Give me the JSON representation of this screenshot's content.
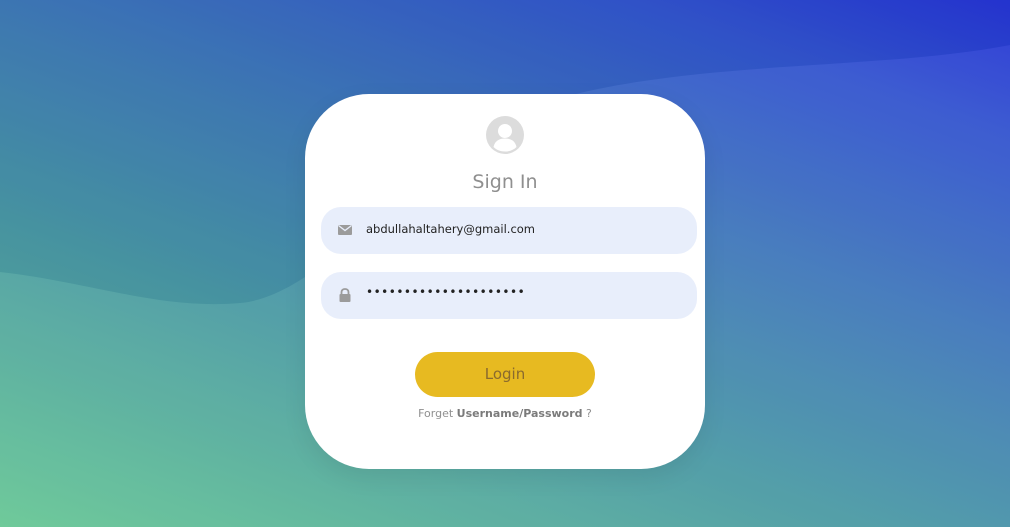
{
  "colors": {
    "card_bg": "#ffffff",
    "field_bg": "#e8eefb",
    "button_bg": "#e7ba21",
    "button_text": "#8a6a2e",
    "muted_text": "#8f8f8f"
  },
  "form": {
    "avatar_icon": "user-circle-icon",
    "title": "Sign In",
    "email": {
      "icon": "envelope-icon",
      "value": "abdullahaltahery@gmail.com"
    },
    "password": {
      "icon": "lock-icon",
      "value": "•••••••••••••••••••••"
    },
    "login_label": "Login",
    "forgot": {
      "prefix": "Forget",
      "link": "Username/Password",
      "suffix": "?"
    }
  }
}
